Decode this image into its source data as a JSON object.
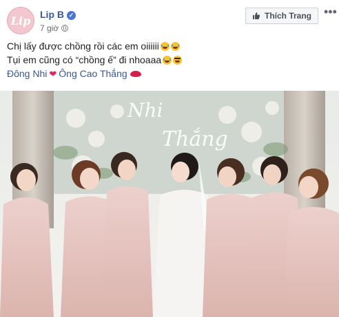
{
  "post": {
    "page_name": "Lip B",
    "timestamp": "7 giờ",
    "like_page_label": "Thích Trang",
    "more_label": "•••",
    "caption_line1": "Chị lấy được chồng rồi các em oiiiiii",
    "caption_line2": "Tụi em cũng có “chồng ế” đi nhoaaa",
    "tag1": "Đông Nhi",
    "tag2": "Ông Cao Thắng"
  },
  "photo": {
    "sign_text_1": "Nhi",
    "sign_text_2": "Thắng"
  },
  "icons": [
    "verified-icon",
    "globe-icon",
    "thumbs-up-icon",
    "more-icon",
    "laughing-emoji",
    "grinning-emoji",
    "heart-emoji",
    "lips-emoji"
  ],
  "colors": {
    "link": "#385898",
    "muted": "#616770",
    "dress": "#e8c4c0",
    "bride_dress": "#f6f4f2"
  }
}
